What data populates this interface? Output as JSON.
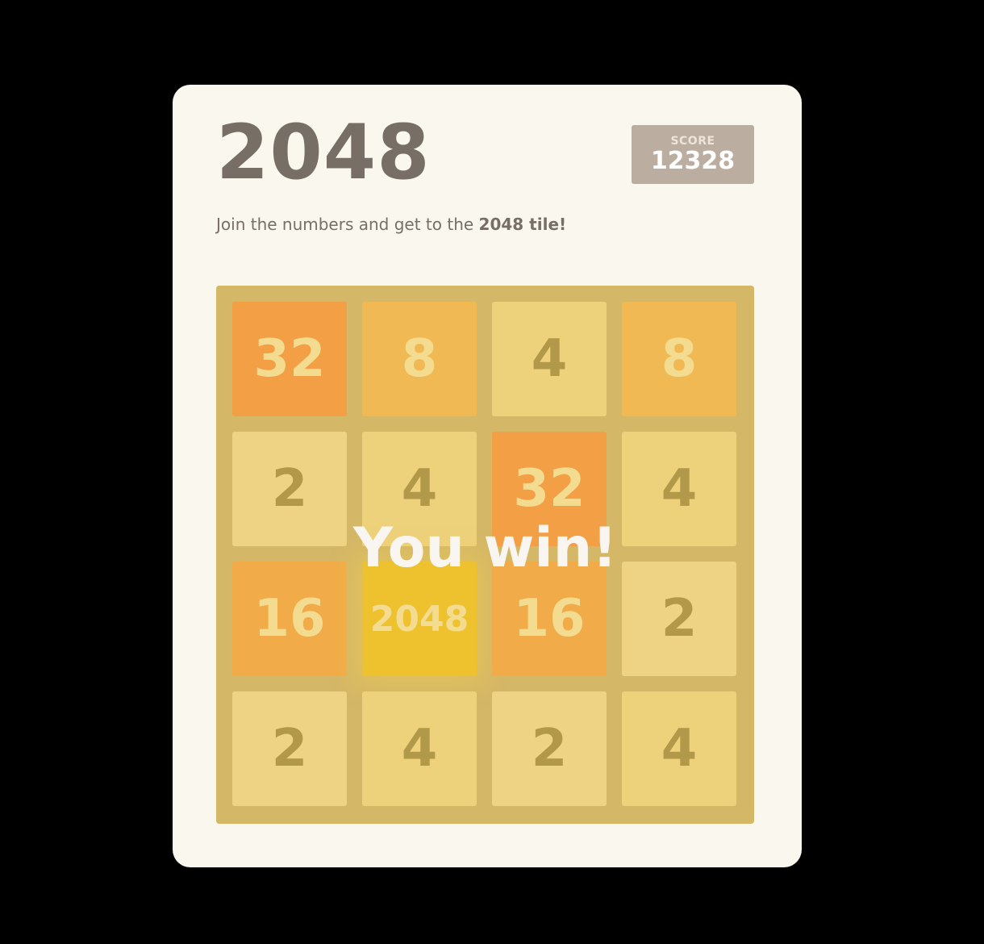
{
  "header": {
    "title": "2048",
    "score_label": "SCORE",
    "score_value": "12328"
  },
  "intro": {
    "text": "Join the numbers and get to the ",
    "bold": "2048 tile!"
  },
  "board": {
    "rows": [
      [
        "32",
        "8",
        "4",
        "8"
      ],
      [
        "2",
        "4",
        "32",
        "4"
      ],
      [
        "16",
        "2048",
        "16",
        "2"
      ],
      [
        "2",
        "4",
        "2",
        "4"
      ]
    ]
  },
  "overlay": {
    "message": "You win!"
  },
  "colors": {
    "background": "#000000",
    "container": "#faf7ef",
    "board": "#bbada0",
    "overlay": "#edc22e",
    "text_dark": "#776e65",
    "text_light": "#f9f6f2"
  }
}
